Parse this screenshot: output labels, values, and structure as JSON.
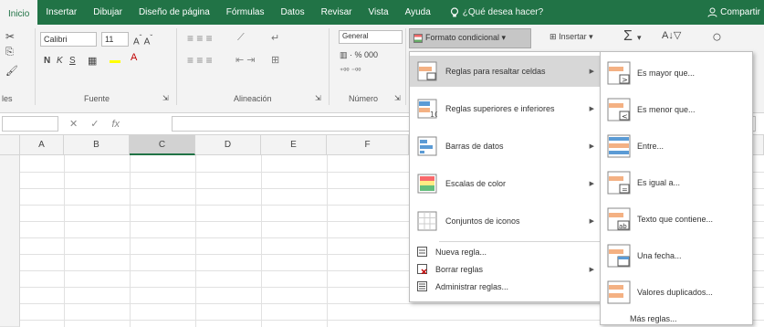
{
  "tabs": [
    "Inicio",
    "Insertar",
    "Dibujar",
    "Diseño de página",
    "Fórmulas",
    "Datos",
    "Revisar",
    "Vista",
    "Ayuda"
  ],
  "tell_me": "¿Qué desea hacer?",
  "share": "Compartir",
  "ribbon": {
    "font_name": "Calibri",
    "font_size": "11",
    "number_format": "General",
    "cond_format": "Formato condicional",
    "insert": "Insertar",
    "groups": {
      "clipboard": "les",
      "font": "Fuente",
      "alignment": "Alineación",
      "number": "Número"
    }
  },
  "columns": [
    "A",
    "B",
    "C",
    "D",
    "E",
    "F"
  ],
  "cf_menu": {
    "items": [
      {
        "label": "Reglas para resaltar celdas",
        "submenu": true
      },
      {
        "label": "Reglas superiores e inferiores",
        "submenu": true
      },
      {
        "label": "Barras de datos",
        "submenu": true
      },
      {
        "label": "Escalas de color",
        "submenu": true
      },
      {
        "label": "Conjuntos de iconos",
        "submenu": true
      }
    ],
    "small_items": [
      {
        "label": "Nueva regla...",
        "submenu": false
      },
      {
        "label": "Borrar reglas",
        "submenu": true
      },
      {
        "label": "Administrar reglas...",
        "submenu": false
      }
    ]
  },
  "highlight_submenu": {
    "items": [
      "Es mayor que...",
      "Es menor que...",
      "Entre...",
      "Es igual a...",
      "Texto que contiene...",
      "Una fecha...",
      "Valores duplicados..."
    ],
    "more": "Más reglas..."
  },
  "accent_color": "#217346"
}
